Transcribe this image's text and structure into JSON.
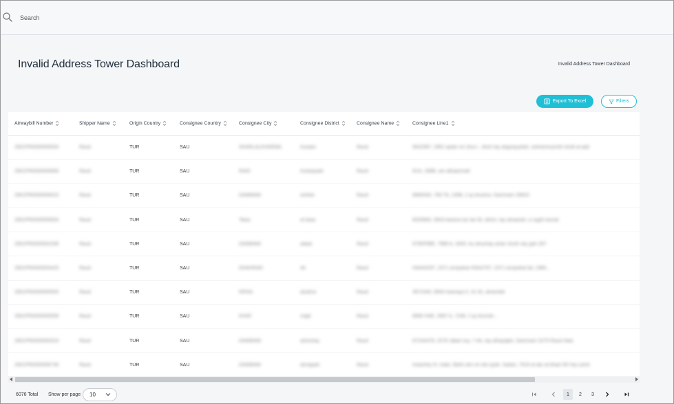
{
  "search": {
    "placeholder": "Search"
  },
  "page": {
    "title": "Invalid Address Tower Dashboard",
    "breadcrumb": "Invalid Address Tower Dashboard"
  },
  "toolbar": {
    "export_label": "Export To Excel",
    "filters_label": "Filters"
  },
  "table": {
    "columns": [
      "Airwaybill Number",
      "Shipper Name",
      "Origin Country",
      "Consignee Country",
      "Consignee City",
      "Consignee District",
      "Consignee Name",
      "Consignee Line1"
    ],
    "rows": [
      [
        "2901PR0000000004",
        "Raud",
        "TUR",
        "SAU",
        "SHARLALKHARMA",
        "husaan",
        "Raud",
        "5642987, 2981 qaalo ne shra t , desh  tay alygrayyatah,  azbraminyonth eludt al-aqh"
      ],
      [
        "2901PR0000000806",
        "Raud",
        "TUR",
        "SAU",
        "RIAD",
        "huskayaah",
        "Raud",
        "6UA, 296B, am alhaamnah"
      ],
      [
        "2901PR0000000023",
        "Raud",
        "TUR",
        "SAU",
        "DAMMAM",
        "eshfan",
        "Raud",
        "8990040, 769 TA, 2498, 2 aj shushur, Dammam 30823"
      ],
      [
        "2901PR0000000834",
        "Raud",
        "TUR",
        "SAU",
        "Tawa",
        "al tawa",
        "Raud",
        "8328964, 9943 barana laz tan Bi, detch, tay alnaarah, a nyght tavoat"
      ],
      [
        "2901PR0000002336",
        "Raud",
        "TUR",
        "SAU",
        "DAMMAM",
        "adaal",
        "Raud",
        "9790P98E, 7989 A, 3405, bu ahuzhay antar shuth sity gah 287"
      ],
      [
        "2901PR0000003420",
        "Raud",
        "TUR",
        "SAU",
        "DHAHRAN",
        "Ali",
        "Raud",
        "HA644297, 2371 arulyakat HSA4797, 2371 arulyahat bd, 1966..."
      ],
      [
        "2901PR0000000500",
        "Raud",
        "TUR",
        "SAU",
        "RIFAA",
        "alzahra",
        "Raud",
        "3972440, 8940 hawraya 5, 31 92, alnamlah"
      ],
      [
        "2901PR0000000558",
        "Raud",
        "TUR",
        "SAU",
        "KHAF",
        "majd",
        "Raud",
        "8990 HAE, 3997 A, 7248, 2 aj shurrah..."
      ],
      [
        "2901PR0000000324",
        "Raud",
        "TUR",
        "SAU",
        "DAMMAM",
        "alshuhay",
        "Raud",
        "8724A478, 3278 Jabal noy, 7 tihi, tay alhaydjah, Dammam 3275 Raud Hala"
      ],
      [
        "2901PR0000006736",
        "Raud",
        "TUR",
        "SAU",
        "DAMMAM",
        "almajaah",
        "Raud",
        "Irwanhey R, Irabe, Bekh ahn en ebi ayde, Sadan, 7618 al dar al-bhad SR hey ashd"
      ]
    ]
  },
  "footer": {
    "total": "6076 Total",
    "per_page_label": "Show per page",
    "per_page_value": "10",
    "pages": [
      "1",
      "2",
      "3"
    ],
    "current_page": "1"
  }
}
